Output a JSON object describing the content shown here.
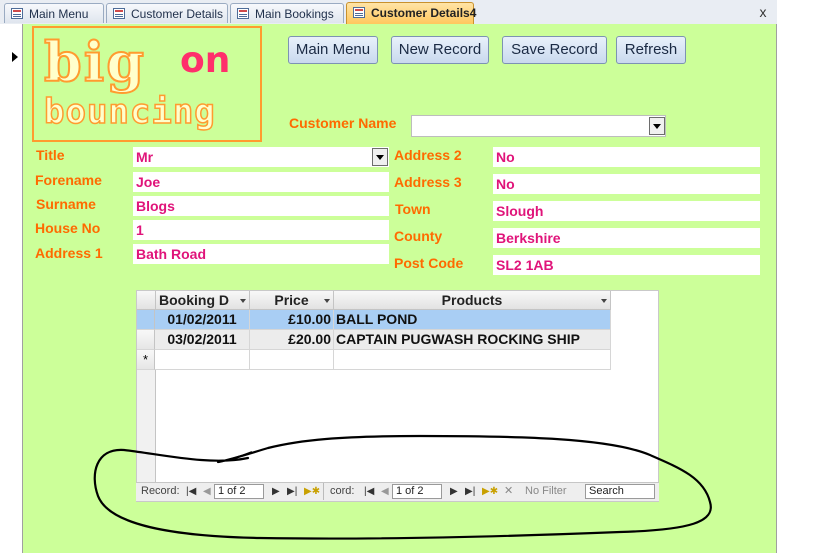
{
  "tabs": [
    {
      "label": "Main Menu",
      "active": false
    },
    {
      "label": "Customer Details",
      "active": false
    },
    {
      "label": "Main Bookings",
      "active": false
    },
    {
      "label": "Customer Details4",
      "active": true
    }
  ],
  "close_glyph": "x",
  "logo": {
    "line1": "big",
    "line2": "on",
    "line3": "bouncing"
  },
  "buttons": {
    "main_menu": "Main Menu",
    "new_record": "New Record",
    "save_record": "Save Record",
    "refresh": "Refresh"
  },
  "customer_name": {
    "label": "Customer Name",
    "value": ""
  },
  "fields": {
    "title": {
      "label": "Title",
      "value": "Mr"
    },
    "forename": {
      "label": "Forename",
      "value": "Joe"
    },
    "surname": {
      "label": "Surname",
      "value": "Blogs"
    },
    "house_no": {
      "label": "House No",
      "value": "1"
    },
    "address1": {
      "label": "Address 1",
      "value": "Bath Road"
    },
    "address2": {
      "label": "Address 2",
      "value": "No"
    },
    "address3": {
      "label": "Address 3",
      "value": "No"
    },
    "town": {
      "label": "Town",
      "value": "Slough"
    },
    "county": {
      "label": "County",
      "value": "Berkshire"
    },
    "post_code": {
      "label": "Post Code",
      "value": "SL2 1AB"
    }
  },
  "subform": {
    "columns": [
      "Booking D",
      "Price",
      "Products"
    ],
    "rows": [
      {
        "date": "01/02/2011",
        "price": "£10.00",
        "product": "BALL POND"
      },
      {
        "date": "03/02/2011",
        "price": "£20.00",
        "product": "CAPTAIN PUGWASH ROCKING SHIP"
      }
    ],
    "new_row_marker": "*"
  },
  "navbar": {
    "record_label": "Record:",
    "record_value": "1 of 2",
    "record_label2": "cord:",
    "record_value2": "1 of 2",
    "no_filter": "No Filter",
    "search": "Search"
  },
  "colors": {
    "form_bg": "#ccff99",
    "label": "#ff6a00",
    "value": "#e0147a",
    "selected_row": "#a9cef4"
  }
}
